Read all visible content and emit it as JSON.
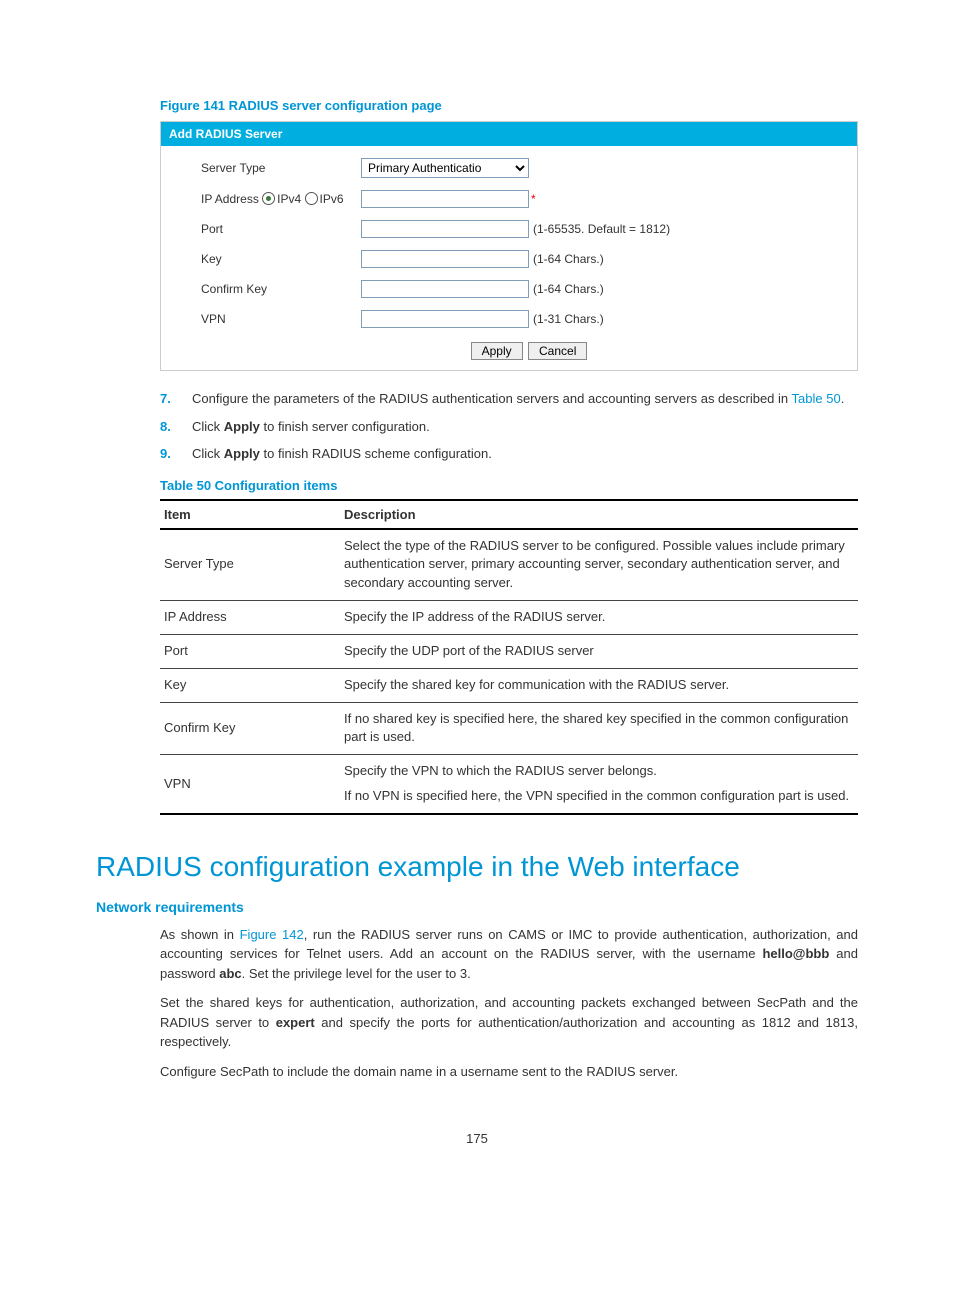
{
  "figure_caption": "Figure 141 RADIUS server configuration page",
  "panel": {
    "title": "Add RADIUS Server",
    "server_type_label": "Server Type",
    "server_type_value": "Primary Authenticatio",
    "ip_addr_label": "IP Address",
    "ipv4_label": "IPv4",
    "ipv6_label": "IPv6",
    "ip_value": "",
    "port_label": "Port",
    "port_value": "",
    "port_hint": "(1-65535. Default = 1812)",
    "key_label": "Key",
    "key_value": "",
    "key_hint": "(1-64 Chars.)",
    "confirm_label": "Confirm Key",
    "confirm_value": "",
    "confirm_hint": "(1-64 Chars.)",
    "vpn_label": "VPN",
    "vpn_value": "",
    "vpn_hint": "(1-31 Chars.)",
    "apply_label": "Apply",
    "cancel_label": "Cancel",
    "asterisk": "*"
  },
  "steps": {
    "s7_num": "7.",
    "s7_a": "Configure the parameters of the RADIUS authentication servers and accounting servers as described in ",
    "s7_link": "Table 50",
    "s7_b": ".",
    "s8_num": "8.",
    "s8_a": "Click ",
    "s8_bold": "Apply",
    "s8_b": " to finish server configuration.",
    "s9_num": "9.",
    "s9_a": "Click ",
    "s9_bold": "Apply",
    "s9_b": " to finish RADIUS scheme configuration."
  },
  "table_caption": "Table 50 Configuration items",
  "table": {
    "h_item": "Item",
    "h_desc": "Description",
    "rows": [
      {
        "item": "Server Type",
        "desc": "Select the type of the RADIUS server to be configured. Possible values include primary authentication server, primary accounting server, secondary authentication server, and secondary accounting server."
      },
      {
        "item": "IP Address",
        "desc": "Specify the IP address of the RADIUS server."
      },
      {
        "item": "Port",
        "desc": "Specify the UDP port of the RADIUS server"
      },
      {
        "item": "Key",
        "desc": "Specify the shared key for communication with the RADIUS server."
      },
      {
        "item": "Confirm Key",
        "desc": "If no shared key is specified here, the shared key specified in the common configuration part is used."
      }
    ],
    "vpn_item": "VPN",
    "vpn_desc_a": "Specify the VPN to which the RADIUS server belongs.",
    "vpn_desc_b": "If no VPN is specified here, the VPN specified in the common configuration part is used."
  },
  "section_heading": "RADIUS configuration example in the Web interface",
  "sub_heading": "Network requirements",
  "p1": {
    "a": "As shown in ",
    "link": "Figure 142",
    "b": ", run the RADIUS server runs on CAMS or IMC to provide authentication, authorization, and accounting services for Telnet users. Add an account on the RADIUS server, with the username ",
    "bold1": "hello@bbb",
    "c": " and password ",
    "bold2": "abc",
    "d": ". Set the privilege level for the user to 3."
  },
  "p2": {
    "a": "Set the shared keys for authentication, authorization, and accounting packets exchanged between SecPath and the RADIUS server to ",
    "bold1": "expert",
    "b": " and specify the ports for authentication/authorization and accounting as 1812 and 1813, respectively."
  },
  "p3": "Configure SecPath to include the domain name in a username sent to the RADIUS server.",
  "page_number": "175"
}
